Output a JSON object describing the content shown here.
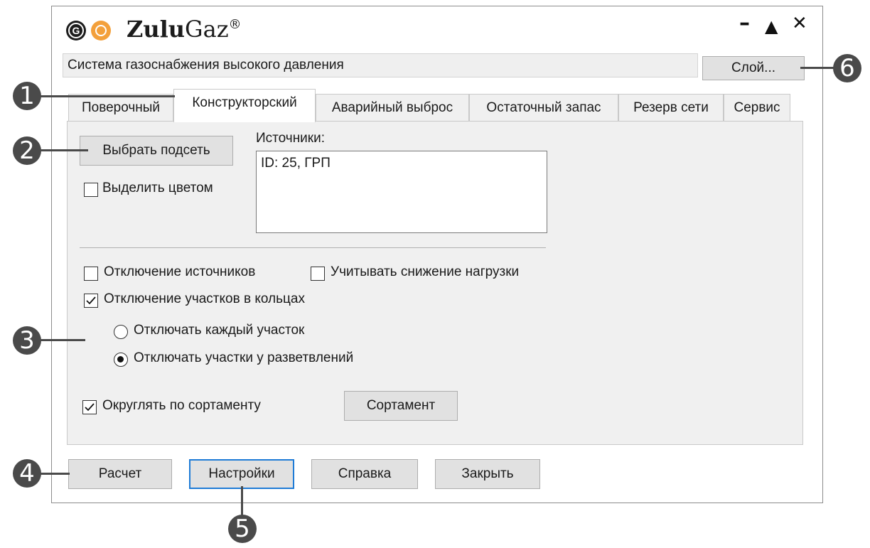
{
  "app": {
    "logo_letter": "G",
    "title_bold": "Zulu",
    "title_regular": "Gaz",
    "title_mark": "®",
    "minimize": "–",
    "maximize": "▲",
    "close": "✕"
  },
  "system_field": "Система газоснабжения высокого давления",
  "layer_button": "Слой...",
  "tabs": [
    {
      "label": "Поверочный",
      "active": false
    },
    {
      "label": "Конструкторский",
      "active": true
    },
    {
      "label": "Аварийный выброс",
      "active": false
    },
    {
      "label": "Остаточный запас",
      "active": false
    },
    {
      "label": "Резерв сети",
      "active": false
    },
    {
      "label": "Сервис",
      "active": false
    }
  ],
  "panel": {
    "select_subnet_button": "Выбрать подсеть",
    "highlight_color": {
      "label": "Выделить цветом",
      "checked": false
    },
    "sources_label": "Источники:",
    "sources": [
      "ID: 25, ГРП"
    ],
    "disable_sources": {
      "label": "Отключение источников",
      "checked": false
    },
    "load_reduction": {
      "label": "Учитывать снижение нагрузки",
      "checked": false
    },
    "disable_ring_sections": {
      "label": "Отключение участков в кольцах",
      "checked": true
    },
    "radio_each_section": {
      "label": "Отключать каждый участок",
      "selected": false
    },
    "radio_branch_sections": {
      "label": "Отключать участки у разветвлений",
      "selected": true
    },
    "round_assortment": {
      "label": "Округлять по сортаменту",
      "checked": true
    },
    "assortment_button": "Сортамент"
  },
  "footer": {
    "calculate": "Расчет",
    "settings": "Настройки",
    "help": "Справка",
    "close": "Закрыть"
  },
  "callouts": [
    "1",
    "2",
    "3",
    "4",
    "5",
    "6"
  ],
  "colors": {
    "accent": "#1e7bd6",
    "logo_orange": "#f3a03b",
    "callout": "#4a4a4a"
  }
}
